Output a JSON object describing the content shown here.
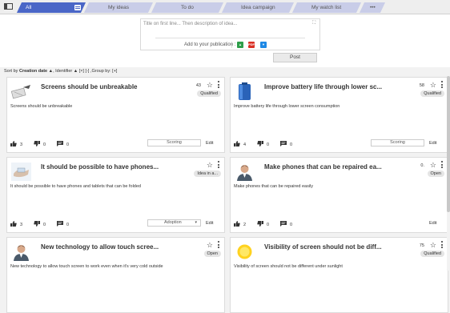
{
  "tabs": [
    {
      "label": "All",
      "active": true
    },
    {
      "label": "My ideas"
    },
    {
      "label": "To do"
    },
    {
      "label": "Idea campaign"
    },
    {
      "label": "My watch list"
    },
    {
      "label": "•••"
    }
  ],
  "composer": {
    "placeholder": "Title on first line... Then description of idea...",
    "publication_label": "Add to your publication :",
    "post_label": "Post",
    "attach_pdf": "PDF"
  },
  "sort": {
    "prefix": "Sort by",
    "field": "Creation date",
    "rest": "▲, Identifier ▲ [×] [-] ,Group by: [+]"
  },
  "cards": [
    {
      "title": "Screens should be unbreakable",
      "score": "43",
      "badge": "Qualified",
      "desc": "Screens should be unbreakable",
      "likes": "3",
      "dislikes": "0",
      "comments": "0",
      "status": "Scoring",
      "status_type": "box",
      "edit": "Edit",
      "thumb": "screens"
    },
    {
      "title": "Improve battery life through lower sc...",
      "score": "58",
      "badge": "Qualified",
      "desc": "Improve battery life through lower screen consumption",
      "likes": "4",
      "dislikes": "0",
      "comments": "0",
      "status": "Scoring",
      "status_type": "box",
      "edit": "Edit",
      "thumb": "battery"
    },
    {
      "title": "It should be possible to have phones...",
      "score": "",
      "badge": "Idea in a...",
      "desc": "It should be possible to have phones and tablets that can be folded",
      "likes": "3",
      "dislikes": "0",
      "comments": "0",
      "status": "Adoption",
      "status_type": "select",
      "edit": "Edit",
      "thumb": "hands"
    },
    {
      "title": "Make phones that can be repaired ea...",
      "score": "0.",
      "badge": "Open",
      "desc": "Make phones that can be repaired easily",
      "likes": "2",
      "dislikes": "0",
      "comments": "0",
      "status": "",
      "status_type": "none",
      "edit": "Edit",
      "thumb": "person"
    },
    {
      "title": "New technology to allow touch scree...",
      "score": "",
      "badge": "Open",
      "desc": "New technology to allow touch screen to work even when it's very cold outside",
      "likes": "",
      "dislikes": "",
      "comments": "",
      "status": "",
      "status_type": "none",
      "edit": "",
      "thumb": "person"
    },
    {
      "title": "Visibility of screen should not be diff...",
      "score": "75",
      "badge": "Qualified",
      "desc": "Visibility of screen should not be different under sunlight",
      "likes": "",
      "dislikes": "",
      "comments": "",
      "status": "",
      "status_type": "none",
      "edit": "",
      "thumb": "sun"
    }
  ],
  "colors": {
    "tab_active": "#4a66c7",
    "tab_inactive": "#c9cde8",
    "green_attach": "#2e9e4a",
    "red_attach": "#d93025",
    "blue_attach": "#1e88e5"
  }
}
